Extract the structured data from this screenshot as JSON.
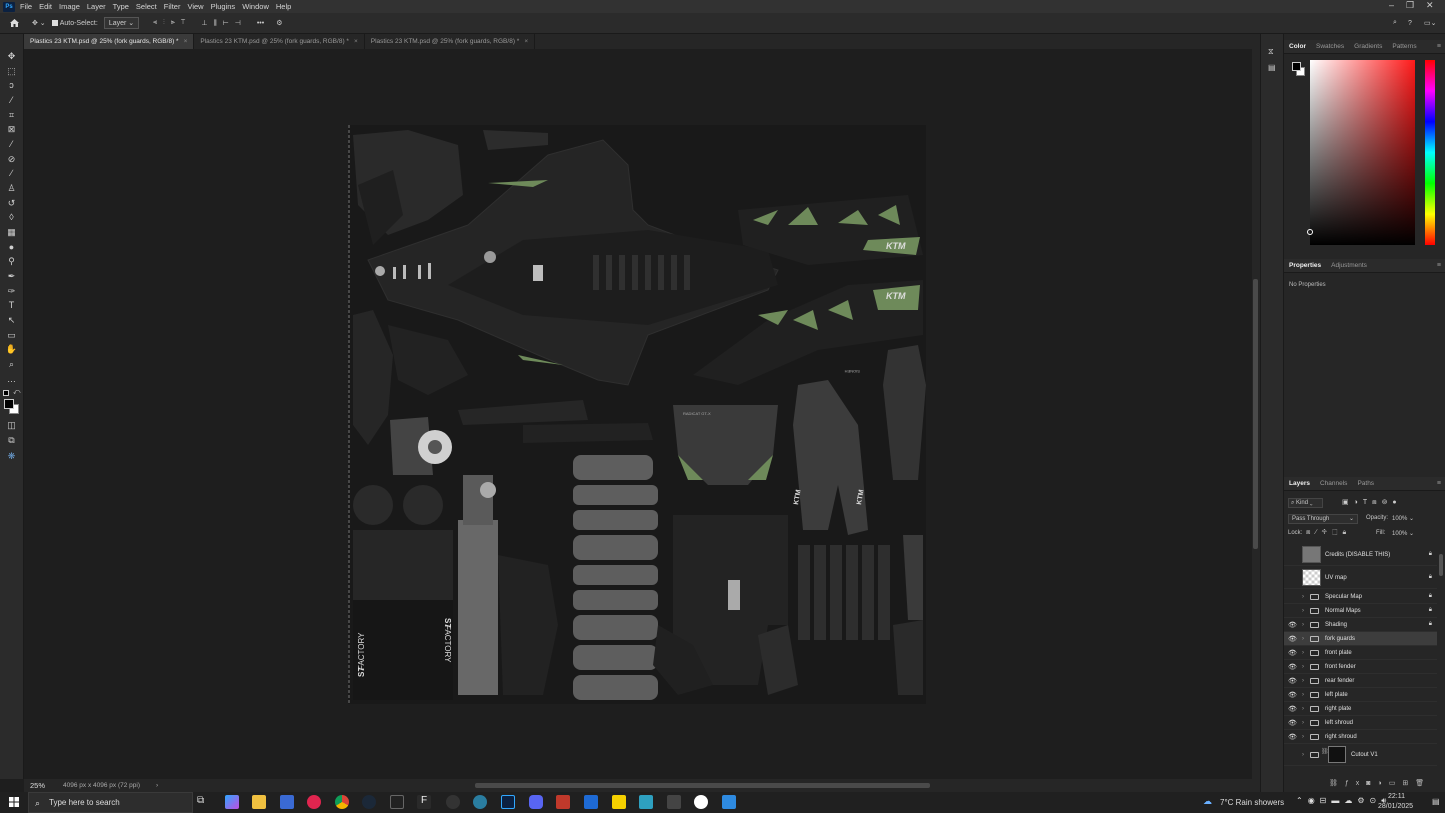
{
  "menubar": {
    "items": [
      "File",
      "Edit",
      "Image",
      "Layer",
      "Type",
      "Select",
      "Filter",
      "View",
      "Plugins",
      "Window",
      "Help"
    ],
    "app_logo": "Ps"
  },
  "optionsbar": {
    "auto_select_label": "Auto-Select:",
    "auto_select_target": "Layer",
    "more": "•••"
  },
  "tabs": [
    {
      "label": "Plastics 23 KTM.psd @ 25% (fork guards, RGB/8) *",
      "active": true
    },
    {
      "label": "Plastics 23 KTM.psd @ 25% (fork guards, RGB/8) *",
      "active": false
    },
    {
      "label": "Plastics 23 KTM.psd @ 25% (fork guards, RGB/8) *",
      "active": false
    }
  ],
  "statusbar": {
    "zoom": "25%",
    "doc_info": "4096 px x 4096 px (72 ppi)",
    "arrow": "›"
  },
  "canvas_labels": {
    "ktm_left": "KTM",
    "ktm_right": "KTM",
    "factory_left": "FACTORY",
    "factory_right": "FACTORY",
    "s7_left": "S7",
    "s7_right": "S7",
    "radicat": "RADICAT GT-X",
    "rotated_text": "SIONEH"
  },
  "color_panel": {
    "tabs": [
      "Color",
      "Swatches",
      "Gradients",
      "Patterns"
    ],
    "active_tab": "Color",
    "hue_color": "#ff0000"
  },
  "properties_panel": {
    "tabs": [
      "Properties",
      "Adjustments"
    ],
    "active_tab": "Properties",
    "empty_text": "No Properties"
  },
  "layers_panel": {
    "tabs": [
      "Layers",
      "Channels",
      "Paths"
    ],
    "active_tab": "Layers",
    "filter_kind": "Kind",
    "blend_mode": "Pass Through",
    "opacity_label": "Opacity:",
    "opacity_value": "100%",
    "lock_label": "Lock:",
    "fill_label": "Fill:",
    "fill_value": "100%",
    "layers": [
      {
        "name": "Credits (DISABLE THIS)",
        "type": "image",
        "visible": false,
        "locked": true
      },
      {
        "name": "UV map",
        "type": "image",
        "visible": false,
        "locked": true
      },
      {
        "name": "Specular Map",
        "type": "group",
        "visible": false,
        "locked": true
      },
      {
        "name": "Normal Maps",
        "type": "group",
        "visible": false,
        "locked": true
      },
      {
        "name": "Shading",
        "type": "group",
        "visible": true,
        "locked": true
      },
      {
        "name": "fork guards",
        "type": "group",
        "visible": true,
        "locked": false,
        "selected": true
      },
      {
        "name": "front plate",
        "type": "group",
        "visible": true,
        "locked": false
      },
      {
        "name": "front fender",
        "type": "group",
        "visible": true,
        "locked": false
      },
      {
        "name": "rear fender",
        "type": "group",
        "visible": true,
        "locked": false
      },
      {
        "name": "left plate",
        "type": "group",
        "visible": true,
        "locked": false
      },
      {
        "name": "right plate",
        "type": "group",
        "visible": true,
        "locked": false
      },
      {
        "name": "left shroud",
        "type": "group",
        "visible": true,
        "locked": false
      },
      {
        "name": "right shroud",
        "type": "group",
        "visible": true,
        "locked": false
      },
      {
        "name": "Cutout V1",
        "type": "group-masked",
        "visible": false,
        "locked": false
      }
    ]
  },
  "taskbar": {
    "search_placeholder": "Type here to search",
    "weather": "7°C  Rain showers",
    "time": "22:11",
    "date": "28/01/2025"
  },
  "accent_colors": {
    "green_graphic": "#6e8a5a",
    "panel_bg": "#262626",
    "selected_row": "#3d3d3d"
  }
}
